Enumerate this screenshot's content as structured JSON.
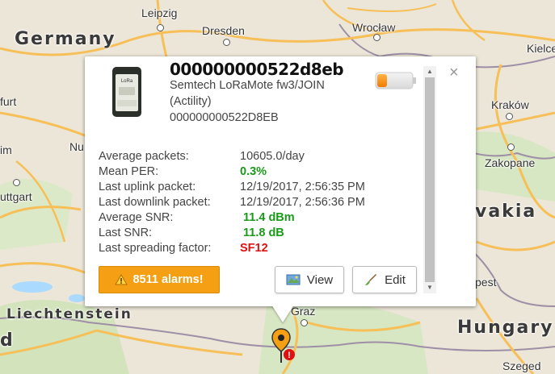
{
  "map": {
    "countries": {
      "germany": "Germany",
      "liechtenstein": "Liechtenstein",
      "hungary": "Hungary",
      "slovakia_partial": "vakia",
      "left_edge_d": "d"
    },
    "cities": {
      "leipzig": "Leipzig",
      "dresden": "Dresden",
      "wroclaw": "Wrocław",
      "kielce_partial": "Kielce",
      "krakow": "Kraków",
      "zakopane": "Zakopane",
      "furt_partial": "furt",
      "im_partial": "im",
      "nu_partial": "Nu",
      "stuttgart_partial": "uttgart",
      "graz": "Graz",
      "szeged": "Szeged",
      "pest_partial": "pest"
    },
    "colors": {
      "land": "#ece6d8",
      "road": "#f6bf57",
      "border": "#9e8fa6",
      "forest": "#cfe1b9"
    }
  },
  "popup": {
    "close_icon": "×",
    "device": {
      "id": "000000000522d8eb",
      "model": "Semtech LoRaMote fw3/JOIN",
      "join_mode": "(Actility)",
      "eui": "000000000522D8EB",
      "image_label": "LoRa"
    },
    "battery_icon": "battery-low-icon",
    "stats": [
      {
        "label": "Average packets:",
        "value": "10605.0/day",
        "style": "normal"
      },
      {
        "label": "Mean PER:",
        "value": "0.3%",
        "style": "green"
      },
      {
        "label": "Last uplink packet:",
        "value": "12/19/2017, 2:56:35 PM",
        "style": "normal"
      },
      {
        "label": "Last downlink packet:",
        "value": "12/19/2017, 2:56:36 PM",
        "style": "normal"
      },
      {
        "label": "Average SNR:",
        "value": "11.4 dBm",
        "style": "green"
      },
      {
        "label": "Last SNR:",
        "value": "11.8 dB",
        "style": "green"
      },
      {
        "label": "Last spreading factor:",
        "value": "SF12",
        "style": "red"
      }
    ],
    "buttons": {
      "alarms": "8511 alarms!",
      "view": "View",
      "edit": "Edit"
    },
    "colors": {
      "alarm": "#f5a014",
      "good": "#1a9a1a",
      "bad": "#e01010"
    }
  }
}
